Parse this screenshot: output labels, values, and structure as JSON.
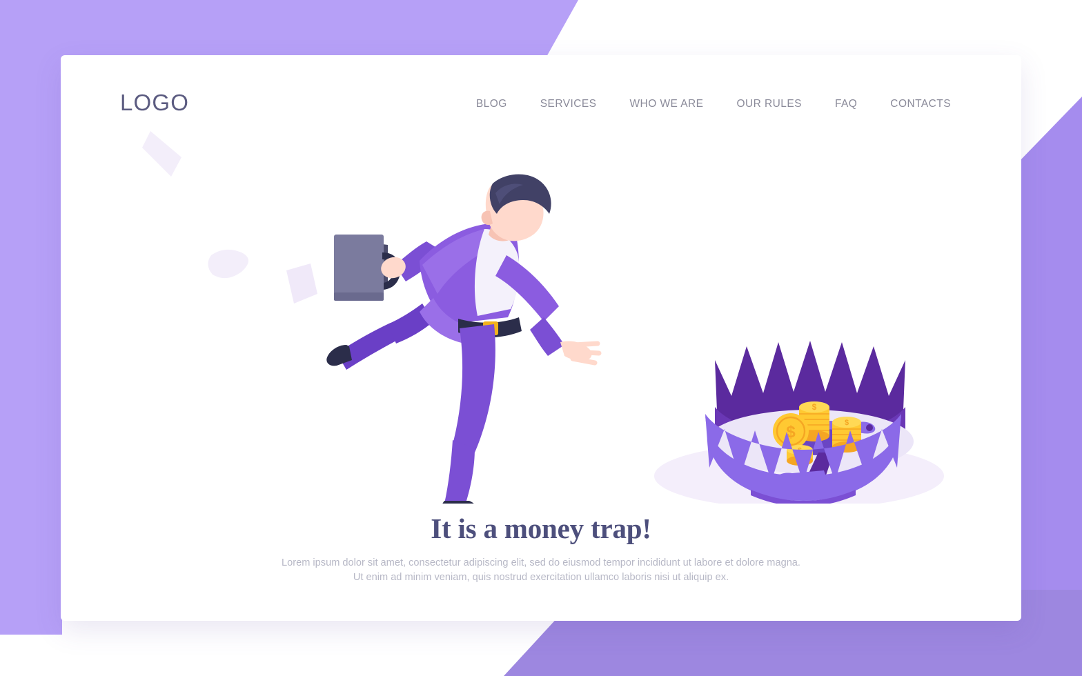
{
  "page": {
    "background_color_top": "#b6a0f7",
    "background_color_right": "#a58cee",
    "background_color_bottom": "#9d87e0",
    "card_color": "#ffffff"
  },
  "header": {
    "logo_text": "LOGO",
    "logo_color": "#5b5b80",
    "nav_items": [
      {
        "label": "BLOG"
      },
      {
        "label": "SERVICES"
      },
      {
        "label": "WHO WE ARE"
      },
      {
        "label": "OUR RULES"
      },
      {
        "label": "FAQ"
      },
      {
        "label": "CONTACTS"
      }
    ]
  },
  "hero": {
    "headline": "It is a money trap!",
    "headline_color": "#4d4f7c",
    "paragraph_line1": "Lorem ipsum dolor sit amet, consectetur adipiscing elit, sed do eiusmod tempor incididunt ut labore et dolore magna.",
    "paragraph_line2": "Ut enim ad minim veniam, quis nostrud exercitation ullamco laboris nisi ut aliquip ex.",
    "paragraph_color": "#b7b8c6"
  },
  "illustration": {
    "businessman": {
      "name": "running-businessman",
      "suit_color": "#7b4fd4",
      "suit_light_color": "#8b5ce0",
      "shirt_color": "#f4f1fb",
      "skin_color": "#ffd9cc",
      "hair_color": "#414166",
      "shoe_color": "#2b2d4a",
      "belt_color": "#2b2d4a",
      "buckle_color": "#f2b21c",
      "briefcase_color": "#7b7b9e",
      "briefcase_dark_color": "#4b4b6b",
      "shadow_color": "#f4eefb"
    },
    "papers": {
      "name": "flying-papers",
      "color": "#f3eefa",
      "count": 3
    },
    "trap": {
      "name": "bear-trap-with-coins",
      "teeth_back_color": "#5b2a9e",
      "teeth_front_color": "#8b6ae8",
      "body_color": "#7b4fd4",
      "plate_color": "#6a45c4",
      "interior_color": "#ece6f8",
      "shadow_color": "#f4eefb",
      "coin_color": "#ffc932",
      "coin_edge_color": "#f5a623",
      "coin_symbol": "$",
      "coin_stacks": 3
    }
  }
}
